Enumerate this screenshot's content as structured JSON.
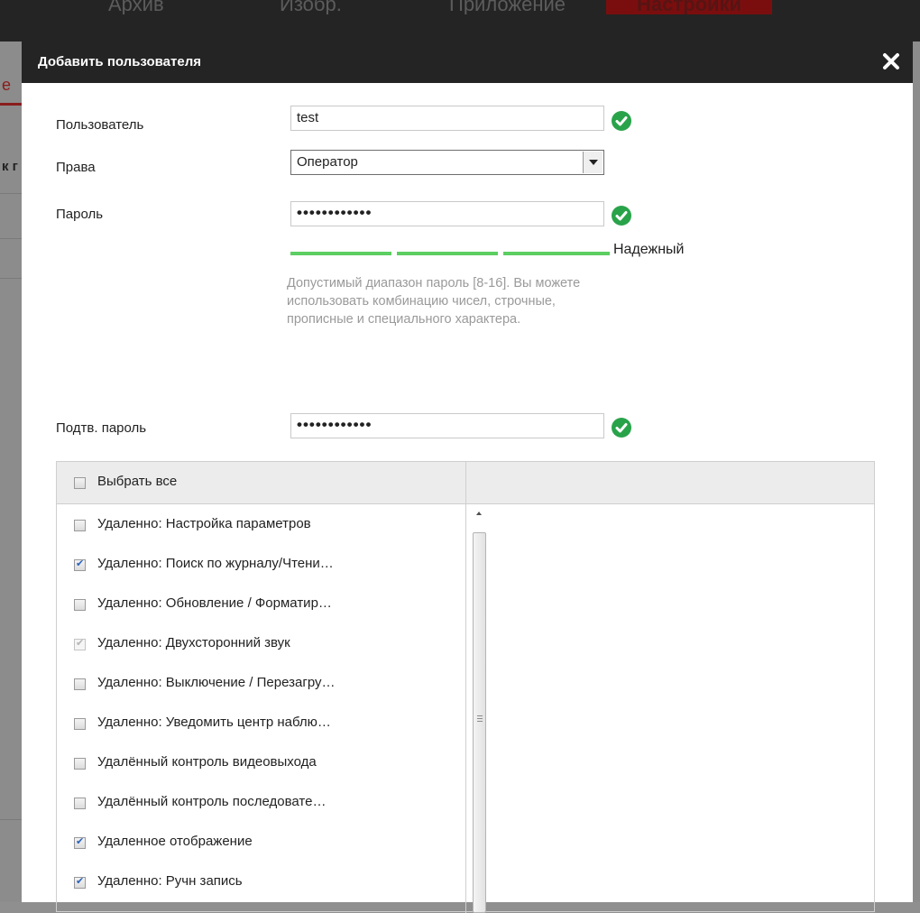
{
  "background_nav": {
    "tabs": [
      "Архив",
      "Изобр.",
      "Приложение",
      "Настройки"
    ],
    "side_letter_e": "e",
    "side_letters_k": "к г"
  },
  "dialog": {
    "title": "Добавить пользователя",
    "close_icon": "close-icon",
    "user_label": "Пользователь",
    "user_value": "test",
    "rights_label": "Права",
    "rights_value": "Оператор",
    "password_label": "Пароль",
    "password_value": "••••••••••••",
    "strength_label": "Надежный",
    "strength_segments": 3,
    "hint": "Допустимый диапазон пароль [8-16]. Вы можете использовать комбинацию чисел, строчные, прописные и специального характера.",
    "confirm_label": "Подтв. пароль",
    "confirm_value": "••••••••••••",
    "valid_icon": "check-circle-icon",
    "colors": {
      "header": "#242424",
      "accent_red": "#8a1c1c",
      "valid_green": "#29a34a",
      "strength_green": "#5cce62"
    }
  },
  "permissions": {
    "select_all_label": "Выбрать все",
    "select_all_checked": false,
    "items": [
      {
        "label": "Удаленно: Настройка параметров",
        "checked": false,
        "disabled": false
      },
      {
        "label": "Удаленно: Поиск по журналу/Чтени…",
        "checked": true,
        "disabled": false
      },
      {
        "label": "Удаленно: Обновление / Форматир…",
        "checked": false,
        "disabled": false
      },
      {
        "label": "Удаленно: Двухсторонний звук",
        "checked": true,
        "disabled": true
      },
      {
        "label": "Удаленно: Выключение / Перезагру…",
        "checked": false,
        "disabled": false
      },
      {
        "label": "Удаленно: Уведомить центр наблю…",
        "checked": false,
        "disabled": false
      },
      {
        "label": "Удалённый контроль видеовыхода",
        "checked": false,
        "disabled": false
      },
      {
        "label": "Удалённый контроль последовате…",
        "checked": false,
        "disabled": false
      },
      {
        "label": "Удаленное отображение",
        "checked": true,
        "disabled": false
      },
      {
        "label": "Удаленно: Ручн запись",
        "checked": true,
        "disabled": false
      }
    ]
  }
}
